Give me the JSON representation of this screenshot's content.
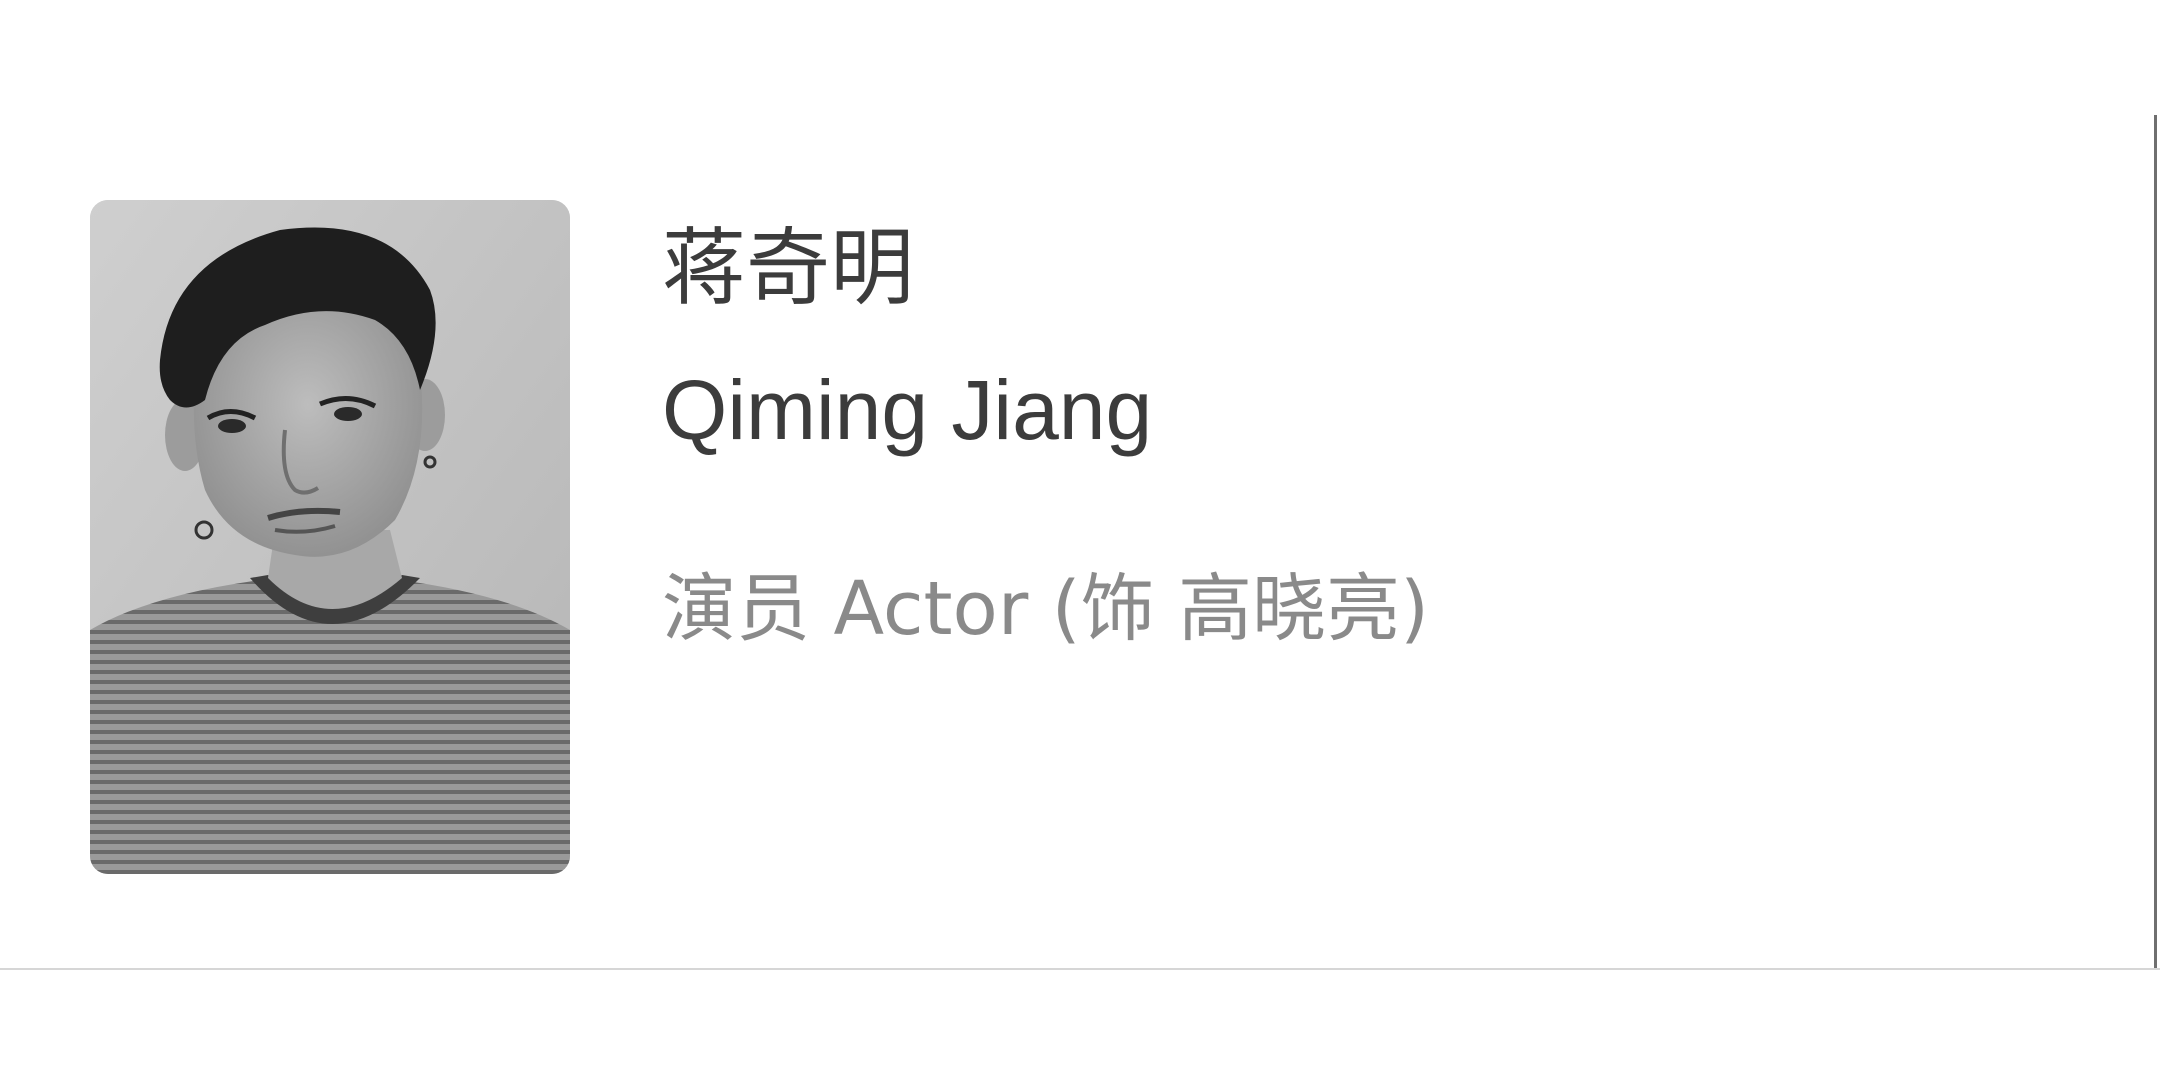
{
  "person": {
    "name_zh": "蒋奇明",
    "name_en": "Qiming Jiang",
    "role": "演员 Actor (饰 高晓亮)",
    "photo_icon": "person-portrait"
  },
  "colors": {
    "name_text": "#3c3c3c",
    "role_text": "#8a8a8a",
    "divider": "#d6d6d6"
  }
}
